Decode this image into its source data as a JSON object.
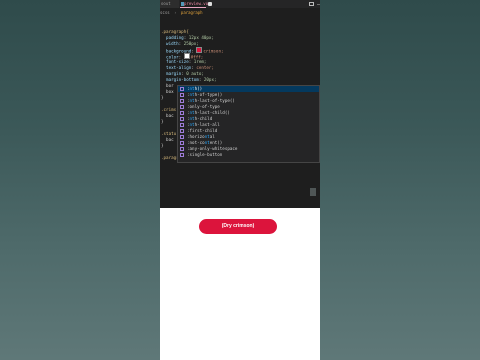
{
  "editor": {
    "tabs": {
      "left": "oout",
      "active": "preview.vue"
    },
    "breadcrumb": {
      "part1": "scss",
      "part2": "paragraph"
    },
    "code_lines": [
      "",
      "",
      ".paragraph{",
      "  padding: 12px 40px;",
      "  width: 250px;",
      "  background: crimson;",
      "  color: #fff;",
      "  font-size: 1rem;",
      "  text-align: center;",
      "  margin: 0 auto;",
      "  margin-bottom: 20px;",
      "  bor",
      "  box",
      "}",
      "",
      ".crims",
      "  bac",
      "}",
      "",
      ".statu",
      "  bac",
      "}",
      "",
      ".paragraph:nt"
    ],
    "suggestions": [
      ":nth()",
      ":nth-of-type()",
      ":nth-last-of-type()",
      ":only-of-type",
      ":nth-last-child()",
      ":nth-child",
      ":nth-last-all",
      ":first-child",
      ":horizontal",
      ":not-content()",
      ":any-only-whitespace",
      ":single-button"
    ],
    "suggest_highlight": "nt"
  },
  "preview": {
    "button_label": "(Dry crimson)"
  },
  "colors": {
    "accent": "#dc143c",
    "editor_bg": "#1e1e1e",
    "suggest_active": "#04395e"
  }
}
